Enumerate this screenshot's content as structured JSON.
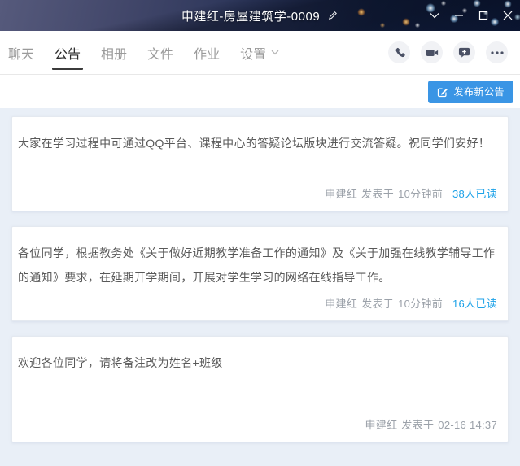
{
  "titlebar": {
    "title": "申建红-房屋建筑学-0009"
  },
  "tabbar": {
    "tabs": [
      {
        "label": "聊天"
      },
      {
        "label": "公告"
      },
      {
        "label": "相册"
      },
      {
        "label": "文件"
      },
      {
        "label": "作业"
      },
      {
        "label": "设置"
      }
    ]
  },
  "toolbar": {
    "publish_button_label": "发布新公告"
  },
  "announcements": [
    {
      "text": "大家在学习过程中可通过QQ平台、课程中心的答疑论坛版块进行交流答疑。祝同学们安好！",
      "author": "申建红",
      "posted_label": "发表于",
      "time": "10分钟前",
      "read_count": "38人已读"
    },
    {
      "text": "各位同学，根据教务处《关于做好近期教学准备工作的通知》及《关于加强在线教学辅导工作的通知》要求，在延期开学期间，开展对学生学习的网络在线指导工作。",
      "author": "申建红",
      "posted_label": "发表于",
      "time": "10分钟前",
      "read_count": "16人已读"
    },
    {
      "text": "欢迎各位同学，请将备注改为姓名+班级",
      "author": "申建红",
      "posted_label": "发表于",
      "time": "02-16 14:37"
    }
  ],
  "colors": {
    "accent_blue": "#3a95e5",
    "link_blue": "#1da2e8",
    "content_bg": "#e9eff7"
  }
}
